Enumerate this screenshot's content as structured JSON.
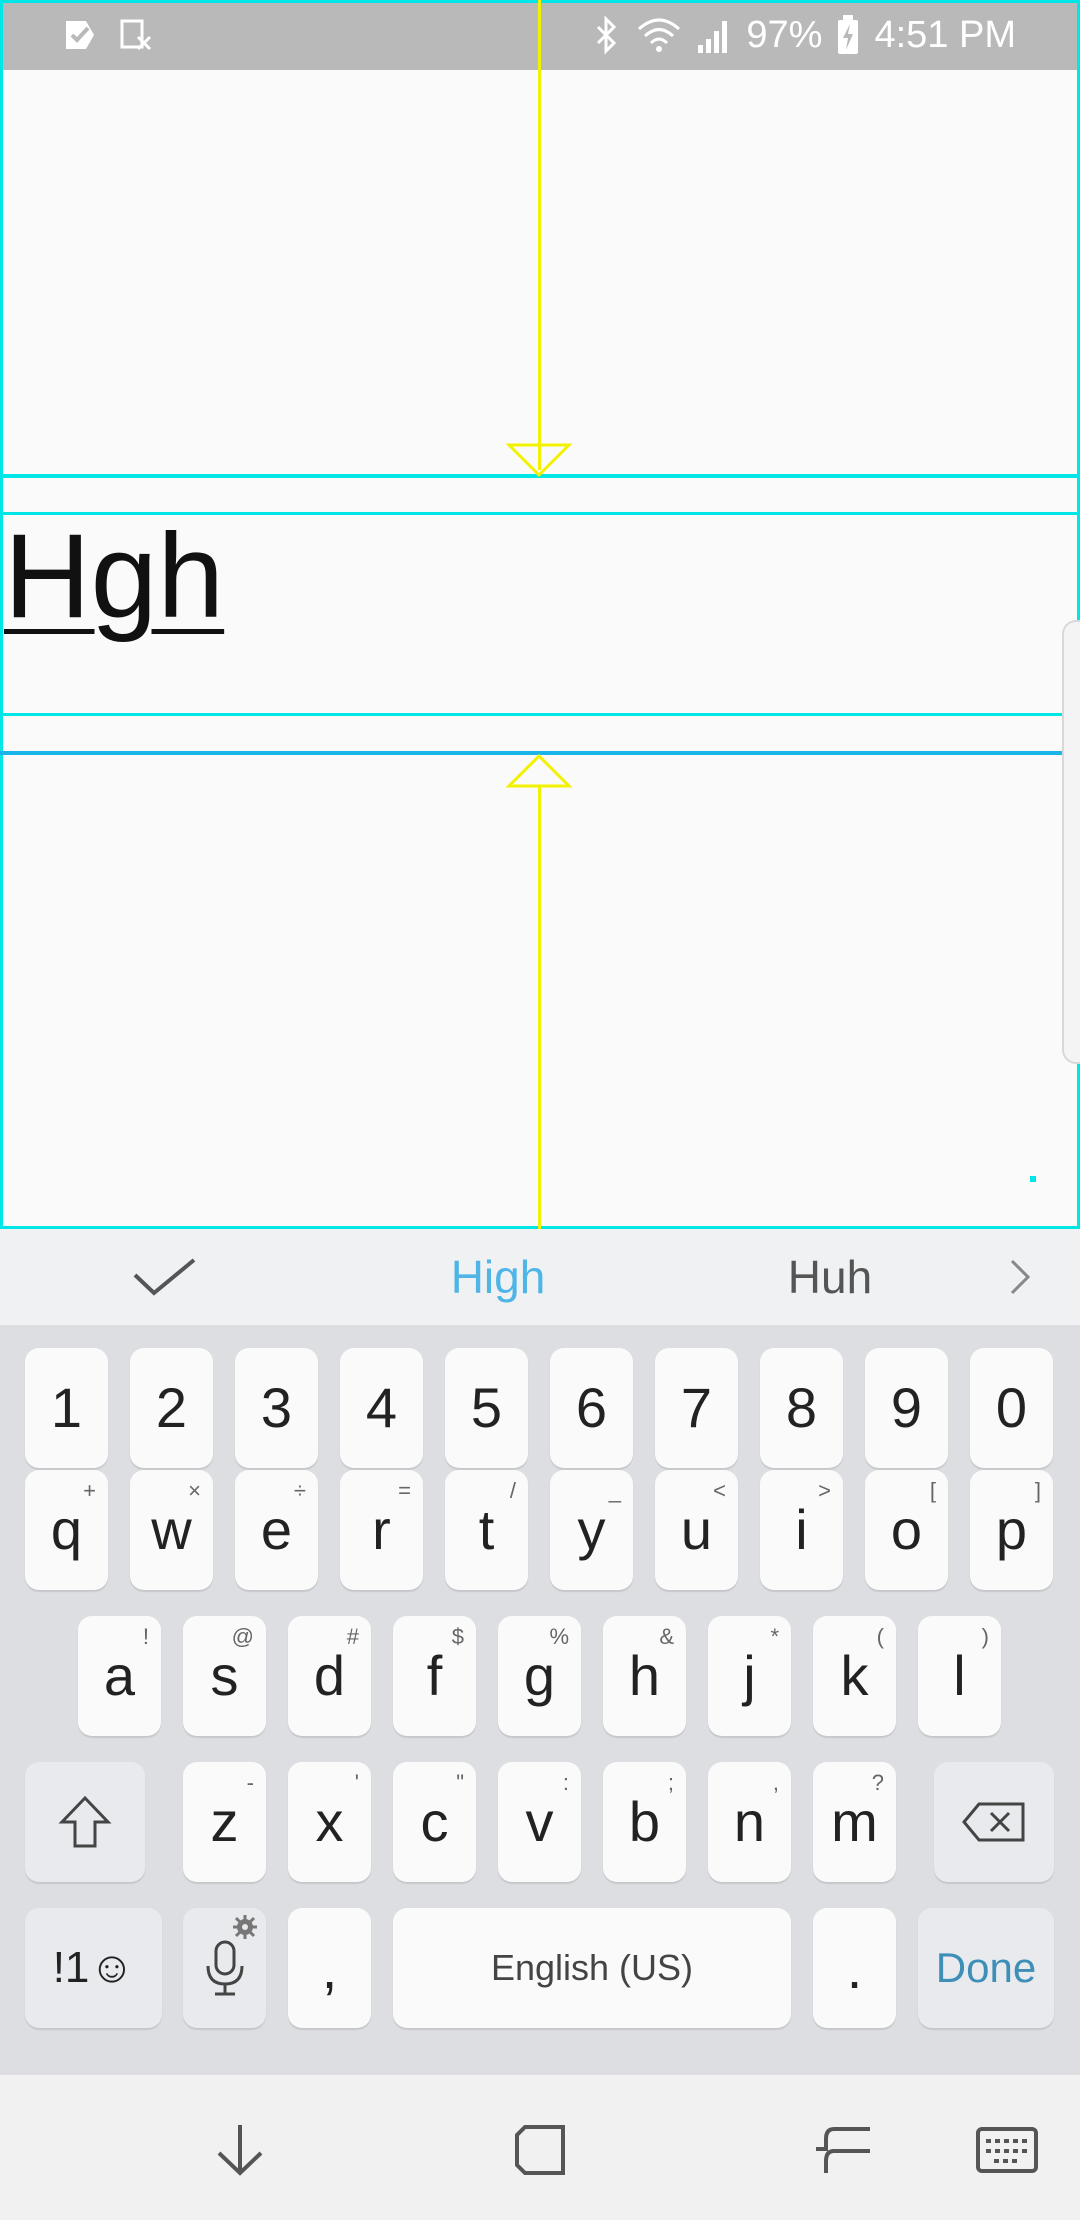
{
  "status_bar": {
    "battery": "97%",
    "time": "4:51 PM",
    "icons": [
      "checkmark-flag-icon",
      "screenshot-icon",
      "bluetooth-icon",
      "wifi-icon",
      "signal-icon",
      "battery-charging-icon"
    ]
  },
  "editor": {
    "text": "Hgh"
  },
  "suggestions": {
    "accept_icon": "checkmark-icon",
    "primary": "High",
    "secondary": "Huh",
    "more_icon": "chevron-right-icon",
    "primary_color": "#4fb5e6"
  },
  "keyboard": {
    "number_row": [
      "1",
      "2",
      "3",
      "4",
      "5",
      "6",
      "7",
      "8",
      "9",
      "0"
    ],
    "row1": [
      {
        "key": "q",
        "hint": "+"
      },
      {
        "key": "w",
        "hint": "×"
      },
      {
        "key": "e",
        "hint": "÷"
      },
      {
        "key": "r",
        "hint": "="
      },
      {
        "key": "t",
        "hint": "/"
      },
      {
        "key": "y",
        "hint": "_"
      },
      {
        "key": "u",
        "hint": "<"
      },
      {
        "key": "i",
        "hint": ">"
      },
      {
        "key": "o",
        "hint": "["
      },
      {
        "key": "p",
        "hint": "]"
      }
    ],
    "row2": [
      {
        "key": "a",
        "hint": "!"
      },
      {
        "key": "s",
        "hint": "@"
      },
      {
        "key": "d",
        "hint": "#"
      },
      {
        "key": "f",
        "hint": "$"
      },
      {
        "key": "g",
        "hint": "%"
      },
      {
        "key": "h",
        "hint": "&"
      },
      {
        "key": "j",
        "hint": "*"
      },
      {
        "key": "k",
        "hint": "("
      },
      {
        "key": "l",
        "hint": ")"
      }
    ],
    "row3": [
      {
        "key": "z",
        "hint": "-"
      },
      {
        "key": "x",
        "hint": "'"
      },
      {
        "key": "c",
        "hint": "\""
      },
      {
        "key": "v",
        "hint": ":"
      },
      {
        "key": "b",
        "hint": ";"
      },
      {
        "key": "n",
        "hint": ","
      },
      {
        "key": "m",
        "hint": "?"
      }
    ],
    "symbols_label": "!1☺",
    "comma": ",",
    "space_label": "English (US)",
    "period": ".",
    "done_label": "Done",
    "done_color": "#3d8fb8"
  },
  "nav_bar": {
    "icons": [
      "hide-keyboard-icon",
      "recent-apps-icon",
      "back-icon",
      "keyboard-switch-icon"
    ]
  }
}
